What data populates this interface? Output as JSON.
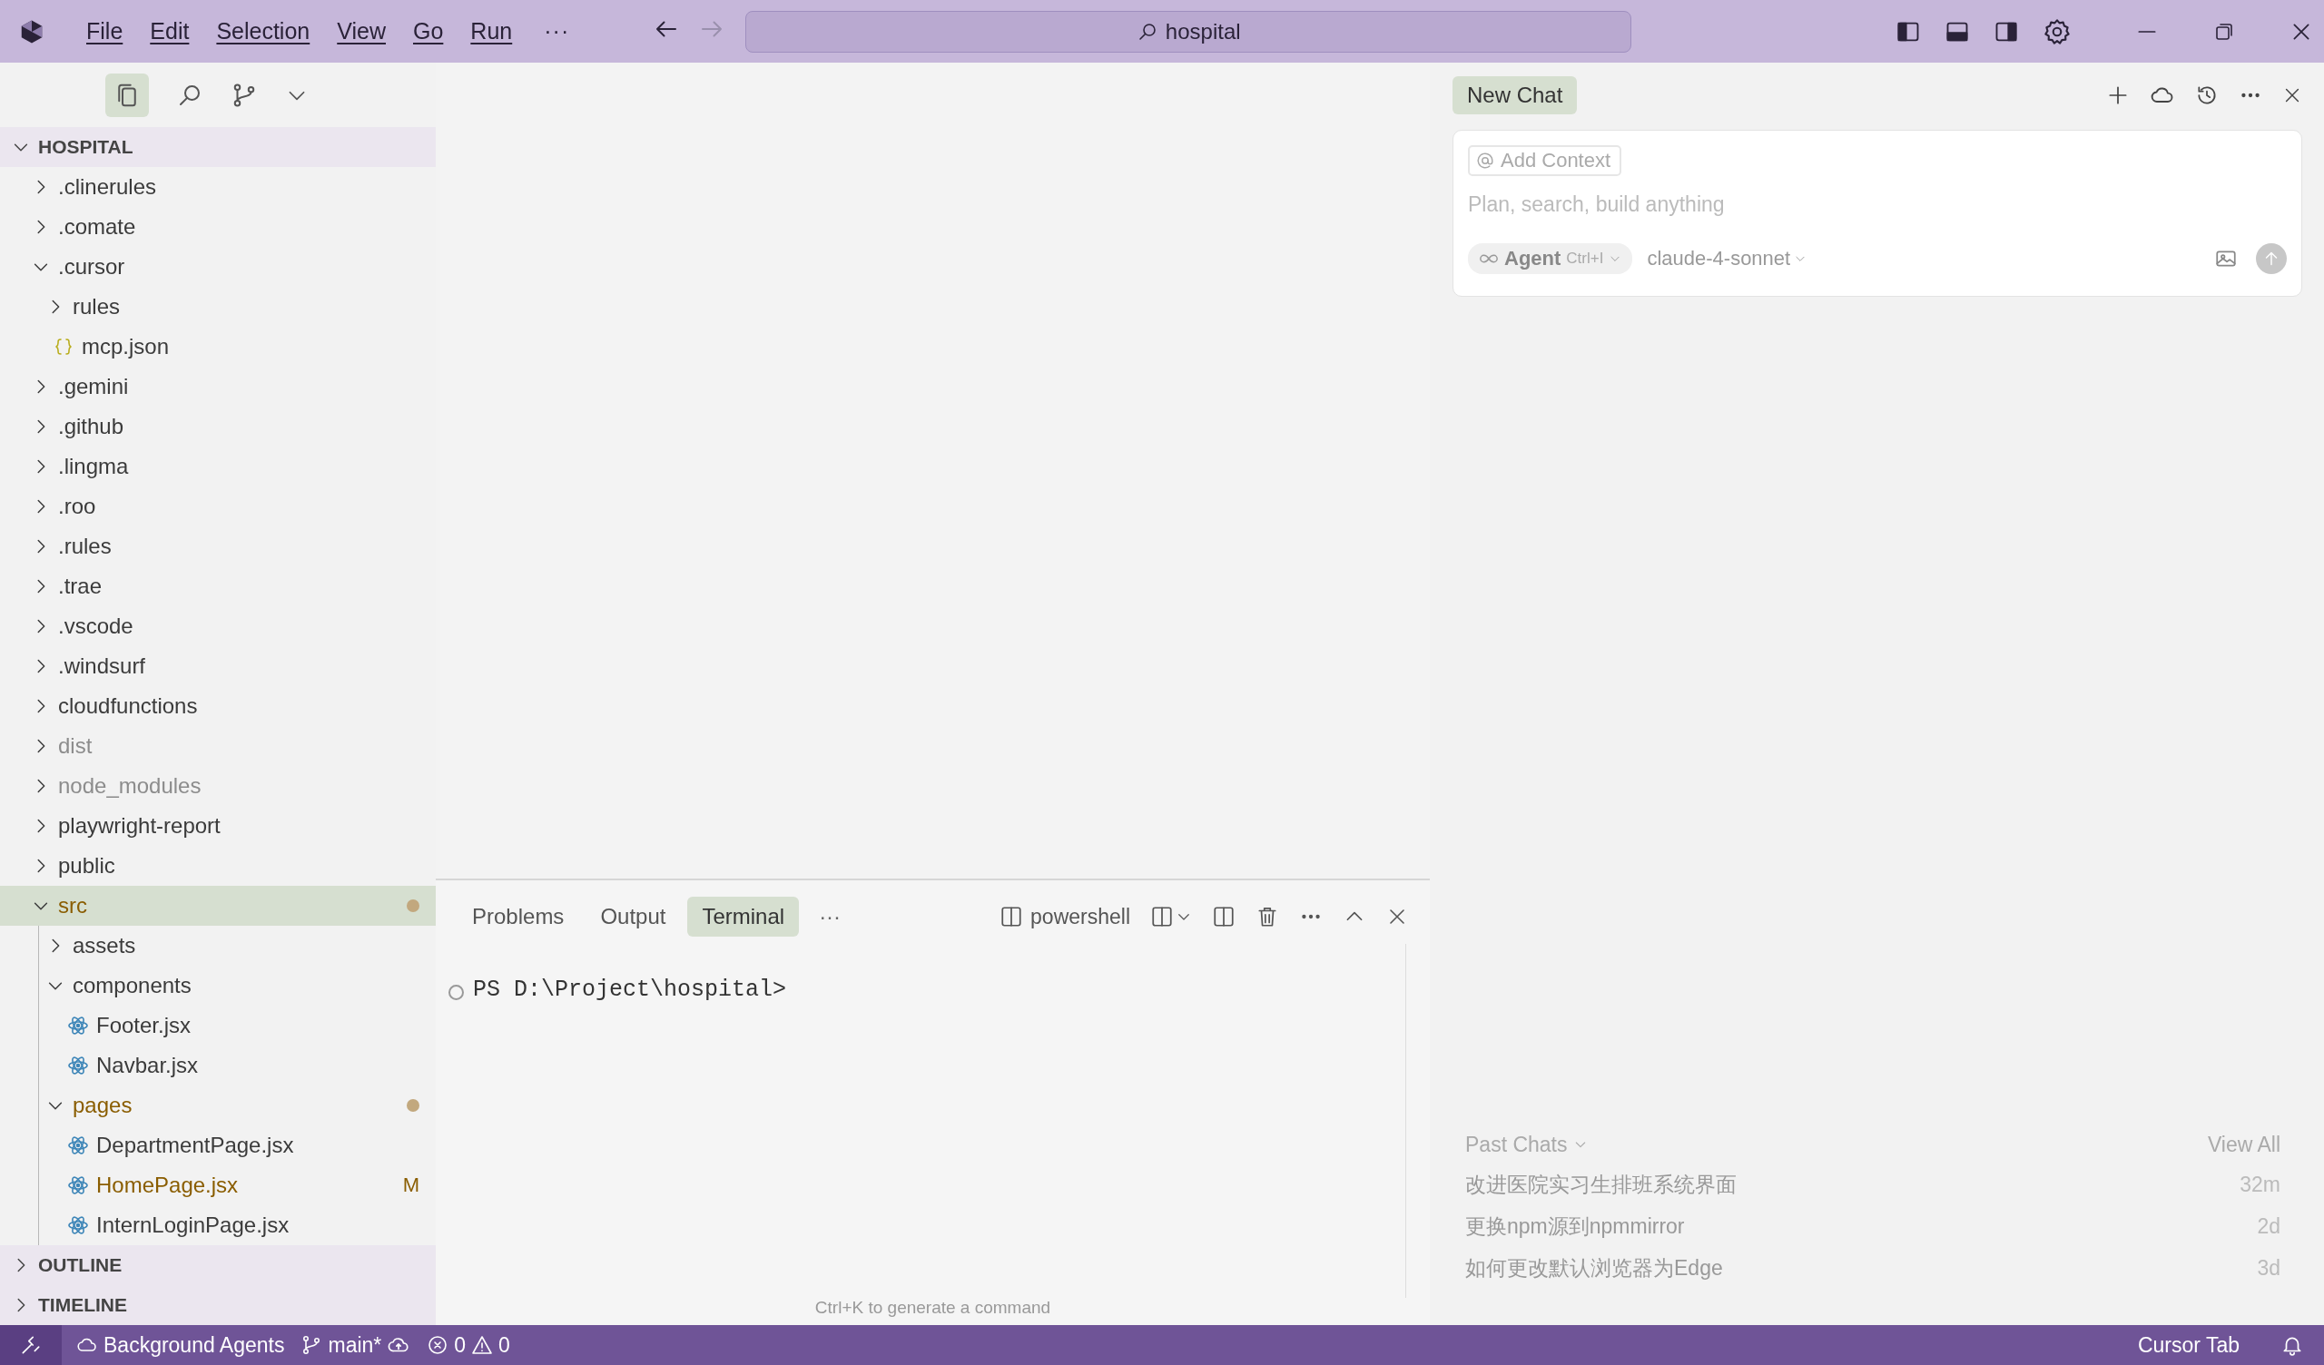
{
  "titlebar": {
    "menus": [
      "File",
      "Edit",
      "Selection",
      "View",
      "Go",
      "Run"
    ],
    "overflow": "···",
    "search": "hospital"
  },
  "sidebar": {
    "root": {
      "label": "HOSPITAL",
      "expanded": true
    },
    "tree": [
      {
        "label": ".clinerules",
        "kind": "folder",
        "expanded": false,
        "selected": false
      },
      {
        "label": ".comate",
        "kind": "folder",
        "expanded": false,
        "selected": false
      },
      {
        "label": ".cursor",
        "kind": "folder",
        "expanded": true,
        "selected": false,
        "children": [
          {
            "label": "rules",
            "kind": "folder",
            "expanded": false,
            "selected": false
          },
          {
            "label": "mcp.json",
            "kind": "json",
            "selected": false
          }
        ]
      },
      {
        "label": ".gemini",
        "kind": "folder",
        "expanded": false,
        "selected": false
      },
      {
        "label": ".github",
        "kind": "folder",
        "expanded": false,
        "selected": false
      },
      {
        "label": ".lingma",
        "kind": "folder",
        "expanded": false,
        "selected": false
      },
      {
        "label": ".roo",
        "kind": "folder",
        "expanded": false,
        "selected": false
      },
      {
        "label": ".rules",
        "kind": "folder",
        "expanded": false,
        "selected": false
      },
      {
        "label": ".trae",
        "kind": "folder",
        "expanded": false,
        "selected": false
      },
      {
        "label": ".vscode",
        "kind": "folder",
        "expanded": false,
        "selected": false
      },
      {
        "label": ".windsurf",
        "kind": "folder",
        "expanded": false,
        "selected": false
      },
      {
        "label": "cloudfunctions",
        "kind": "folder",
        "expanded": false,
        "selected": false
      },
      {
        "label": "dist",
        "kind": "folder",
        "expanded": false,
        "selected": false,
        "ignored": true
      },
      {
        "label": "node_modules",
        "kind": "folder",
        "expanded": false,
        "selected": false,
        "ignored": true
      },
      {
        "label": "playwright-report",
        "kind": "folder",
        "expanded": false,
        "selected": false
      },
      {
        "label": "public",
        "kind": "folder",
        "expanded": false,
        "selected": false
      },
      {
        "label": "src",
        "kind": "folder",
        "expanded": true,
        "selected": true,
        "changed": true,
        "children": [
          {
            "label": "assets",
            "kind": "folder",
            "expanded": false,
            "selected": false
          },
          {
            "label": "components",
            "kind": "folder",
            "expanded": true,
            "selected": false,
            "children": [
              {
                "label": "Footer.jsx",
                "kind": "react",
                "selected": false
              },
              {
                "label": "Navbar.jsx",
                "kind": "react",
                "selected": false
              }
            ]
          },
          {
            "label": "pages",
            "kind": "folder",
            "expanded": true,
            "selected": false,
            "changed": true,
            "children": [
              {
                "label": "DepartmentPage.jsx",
                "kind": "react",
                "selected": false
              },
              {
                "label": "HomePage.jsx",
                "kind": "react",
                "selected": false,
                "modified": true,
                "badge": "M"
              },
              {
                "label": "InternLoginPage.jsx",
                "kind": "react",
                "selected": false
              }
            ]
          }
        ]
      }
    ],
    "sections": [
      {
        "label": "OUTLINE",
        "expanded": false
      },
      {
        "label": "TIMELINE",
        "expanded": false
      }
    ]
  },
  "panel": {
    "tabs": [
      {
        "label": "Problems",
        "selected": false
      },
      {
        "label": "Output",
        "selected": false
      },
      {
        "label": "Terminal",
        "selected": true
      }
    ],
    "overflow": "···",
    "shell": "powershell",
    "prompt": "PS D:\\Project\\hospital>",
    "hint": "Ctrl+K to generate a command"
  },
  "chat": {
    "tab": "New Chat",
    "context_chip": "Add Context",
    "placeholder": "Plan, search, build anything",
    "mode": "Agent",
    "mode_shortcut": "Ctrl+I",
    "model": "claude-4-sonnet",
    "past_chats": {
      "title": "Past Chats",
      "view_all": "View All",
      "items": [
        {
          "title": "改进医院实习生排班系统界面",
          "time": "32m"
        },
        {
          "title": "更换npm源到npmmirror",
          "time": "2d"
        },
        {
          "title": "如何更改默认浏览器为Edge",
          "time": "3d"
        }
      ]
    }
  },
  "status_bar": {
    "agents": "Background Agents",
    "branch": "main*",
    "errors": "0",
    "warnings": "0",
    "right": "Cursor Tab"
  }
}
